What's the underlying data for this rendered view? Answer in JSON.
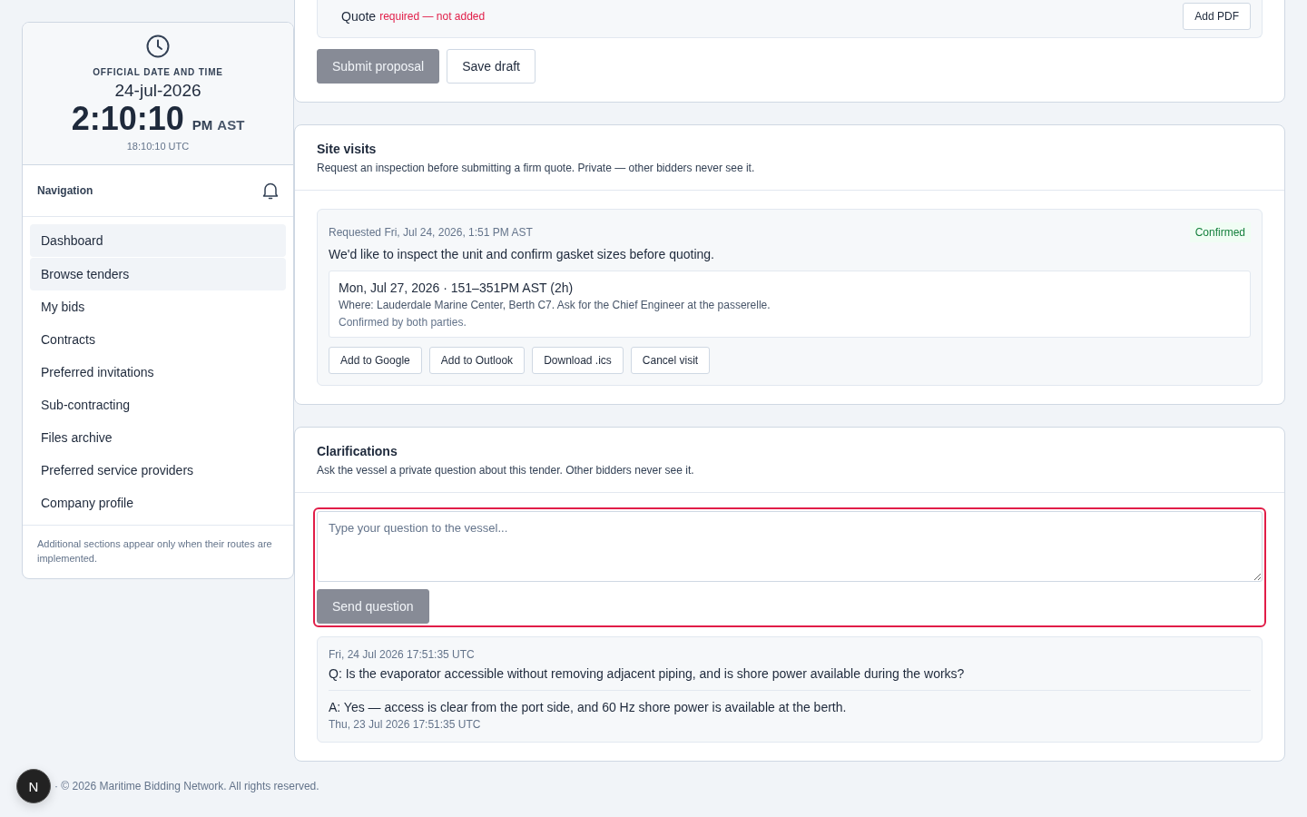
{
  "clock": {
    "label": "OFFICIAL DATE AND TIME",
    "date": "24-jul-2026",
    "time": "2:10:10",
    "meridiem": "PM",
    "zone": "AST",
    "utc": "18:10:10 UTC"
  },
  "navigation": {
    "title": "Navigation",
    "items": [
      {
        "label": "Dashboard",
        "selected": true
      },
      {
        "label": "Browse tenders",
        "selected": true
      },
      {
        "label": "My bids",
        "selected": false
      },
      {
        "label": "Contracts",
        "selected": false
      },
      {
        "label": "Preferred invitations",
        "selected": false
      },
      {
        "label": "Sub-contracting",
        "selected": false
      },
      {
        "label": "Files archive",
        "selected": false
      },
      {
        "label": "Preferred service providers",
        "selected": false
      },
      {
        "label": "Company profile",
        "selected": false
      }
    ],
    "note": "Additional sections appear only when their routes are implemented."
  },
  "proposal": {
    "quote_label": "Quote",
    "quote_status": "required — not added",
    "add_button": "Add PDF",
    "submit_button": {
      "label": "Submit proposal",
      "disabled": true
    },
    "draft_button": "Save draft"
  },
  "site_visits": {
    "title": "Site visits",
    "subtitle": "Request an inspection before submitting a firm quote. Private — other bidders never see it.",
    "visit": {
      "requested": "Requested Fri, Jul 24, 2026, 1:51 PM AST",
      "status": {
        "label": "Confirmed",
        "kind": "success"
      },
      "message": "We'd like to inspect the unit and confirm gasket sizes before quoting.",
      "slot": "Mon, Jul 27, 2026 · 151–351PM AST (2h)",
      "where": "Where: Lauderdale Marine Center, Berth C7. Ask for the Chief Engineer at the passerelle.",
      "confirmation": "Confirmed by both parties.",
      "actions": [
        "Add to Google",
        "Add to Outlook",
        "Download .ics",
        "Cancel visit"
      ]
    }
  },
  "clarifications": {
    "title": "Clarifications",
    "subtitle": "Ask the vessel a private question about this tender. Other bidders never see it.",
    "question_field": {
      "placeholder": "Type your question to the vessel...",
      "focused": true
    },
    "send_button": {
      "label": "Send question",
      "disabled": true
    },
    "thread": [
      {
        "asked": "Fri, 24 Jul 2026 17:51:35 UTC",
        "question": "Q: Is the evaporator accessible without removing adjacent piping, and is shore power available during the works?",
        "answer": "A: Yes — access is clear from the port side, and 60 Hz shore power is available at the berth.",
        "answered": "Thu, 23 Jul 2026 17:51:35 UTC"
      }
    ]
  },
  "footer": {
    "badge": "N",
    "text": "· © 2026 Maritime Bidding Network. All rights reserved."
  }
}
